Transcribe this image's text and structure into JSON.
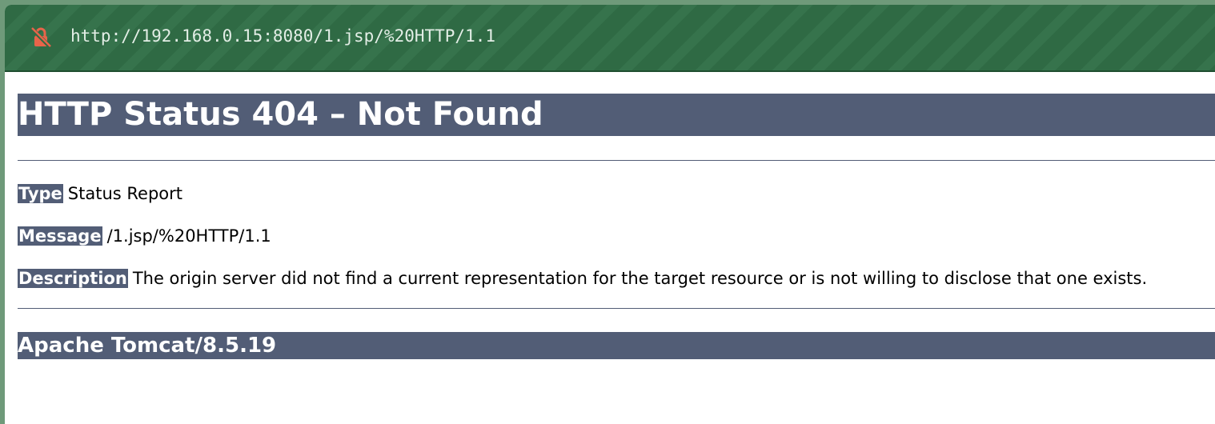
{
  "address_bar": {
    "url": "http://192.168.0.15:8080/1.jsp/%20HTTP/1.1",
    "security_icon": "not-secure-lock-icon",
    "accent_color": "#2f6a44",
    "icon_color": "#e8644a"
  },
  "page": {
    "heading": "HTTP Status 404 – Not Found",
    "rows": [
      {
        "label": "Type",
        "value": "Status Report"
      },
      {
        "label": "Message",
        "value": "/1.jsp/%20HTTP/1.1"
      },
      {
        "label": "Description",
        "value": "The origin server did not find a current representation for the target resource or is not willing to disclose that one exists."
      }
    ],
    "footer": "Apache Tomcat/8.5.19",
    "heading_bg": "#525d76"
  }
}
